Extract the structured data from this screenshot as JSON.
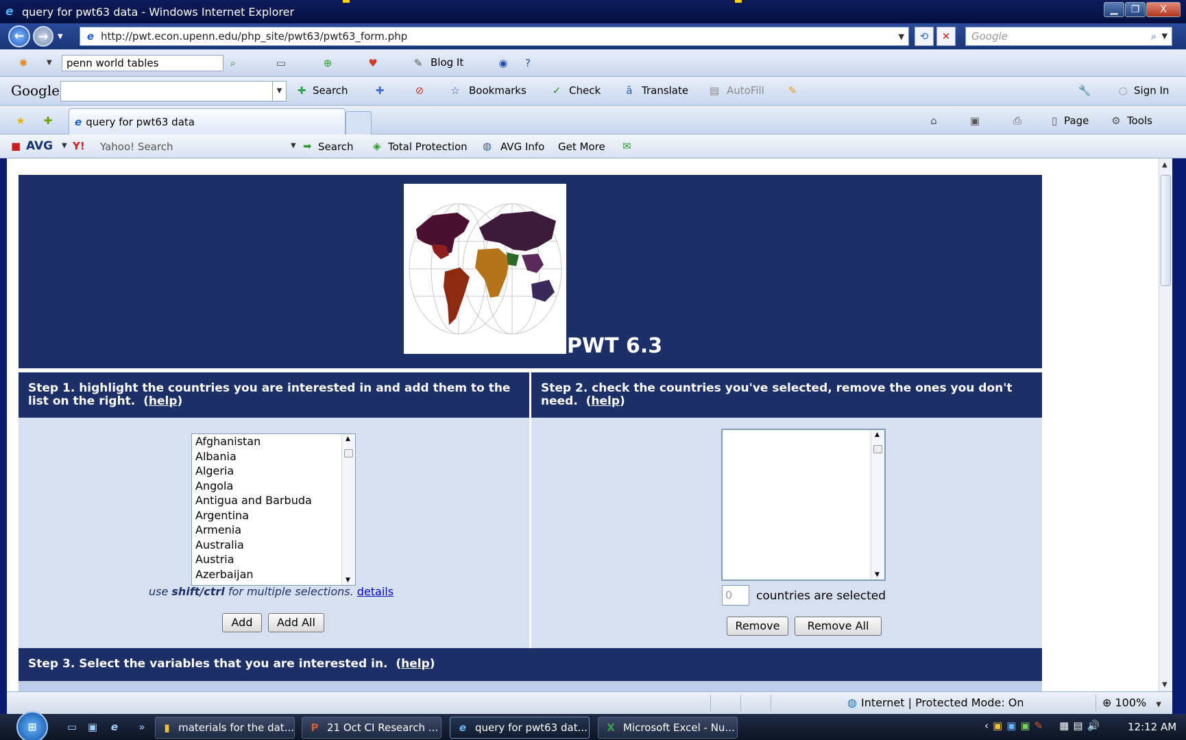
{
  "window": {
    "title": "query for pwt63 data - Windows Internet Explorer",
    "controls": [
      "▁",
      "❐",
      "X"
    ]
  },
  "address": {
    "url": "http://pwt.econ.upenn.edu/php_site/pwt63/pwt63_form.php",
    "search_placeholder": "Google"
  },
  "toolbar1": {
    "search_value": "penn world tables",
    "blog_it": "Blog It"
  },
  "google_bar": {
    "logo": "Google",
    "search": "Search",
    "bookmarks": "Bookmarks",
    "check": "Check",
    "translate": "Translate",
    "autofill": "AutoFill",
    "sign_in": "Sign In"
  },
  "tabs": {
    "active_title": "query for pwt63 data",
    "page": "Page",
    "tools": "Tools"
  },
  "avg_bar": {
    "logo": "AVG",
    "yahoo_search": "Yahoo! Search",
    "search": "Search",
    "total_protection": "Total Protection",
    "avg_info": "AVG Info",
    "get_more": "Get More"
  },
  "page": {
    "banner_title": "PWT 6.3",
    "step1": {
      "heading": "Step 1. highlight the countries you are interested in and add them to the list on the right.",
      "help": "help"
    },
    "step2": {
      "heading": "Step 2. check the countries you've selected, remove the ones you don't need.",
      "help": "help"
    },
    "step3": {
      "heading": "Step 3. Select the variables that you are interested in.",
      "help": "help"
    },
    "countries": [
      "Afghanistan",
      "Albania",
      "Algeria",
      "Angola",
      "Antigua and Barbuda",
      "Argentina",
      "Armenia",
      "Australia",
      "Austria",
      "Azerbaijan"
    ],
    "hint_prefix": "use ",
    "hint_keys": "shift/ctrl",
    "hint_suffix": " for multiple selections. ",
    "details": "details",
    "add": "Add",
    "add_all": "Add All",
    "selected_count": "0",
    "selected_label": "countries are selected",
    "remove": "Remove",
    "remove_all": "Remove All"
  },
  "status": {
    "zone": "Internet | Protected Mode: On",
    "zoom": "100%"
  },
  "taskbar": {
    "tasks": [
      "materials for the dat...",
      "21 Oct CI Research ...",
      "query for pwt63 dat...",
      "Microsoft Excel - Nu..."
    ],
    "clock": "12:12 AM"
  }
}
